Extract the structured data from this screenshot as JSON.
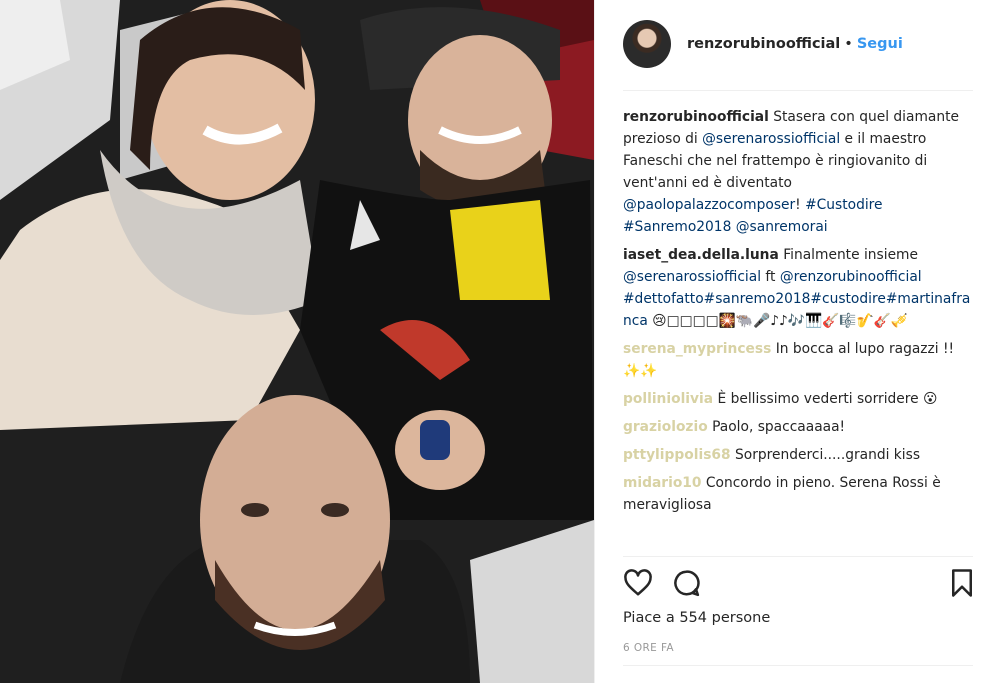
{
  "post": {
    "username": "renzorubinoofficial",
    "separator": "•",
    "follow_label": "Segui",
    "likes_text": "Piace a 554 persone",
    "time_text": "6 ORE FA"
  },
  "caption": {
    "user": "renzorubinoofficial",
    "text_a": " Stasera con quel diamante prezioso di ",
    "mention_a": "@serenarossiofficial",
    "text_b": " e il maestro Faneschi che nel frattempo è ringiovanito di vent'anni ed è diventato ",
    "mention_b": "@paolopalazzocomposer",
    "text_c": "! ",
    "tags": "#Custodire #Sanremo2018 @sanremorai"
  },
  "comments": [
    {
      "user": "iaset_dea.della.luna",
      "text": " Finalmente insieme ",
      "mention_a": "@serenarossiofficial",
      "text_b": " ft ",
      "mention_b": "@renzorubinoofficial",
      "tags": " #dettofatto#sanremo2018#custodire#martinafranca",
      "emoji": " 😢□□□□🎇🐃🎤♪♪🎶🎹🎸🎼🎷🎸🎺"
    },
    {
      "user": "serena_myprincess",
      "text": " In bocca al lupo ragazzi !!✨✨"
    },
    {
      "user": "polliniolivia",
      "text": " È bellissimo vederti sorridere 😮"
    },
    {
      "user": "graziolozio",
      "text": " Paolo, spaccaaaaa!"
    },
    {
      "user": "pttylippolis68",
      "text": " Sorprenderci.....grandi kiss"
    },
    {
      "user": "midario10",
      "text": " Concordo in pieno. Serena Rossi è meravigliosa"
    }
  ],
  "icons": {
    "like": "heart-icon",
    "comment": "comment-icon",
    "save": "bookmark-icon"
  },
  "colors": {
    "link": "#3897f0",
    "mention": "#003569",
    "faded_user": "#d8d2a4",
    "time": "#999999"
  }
}
